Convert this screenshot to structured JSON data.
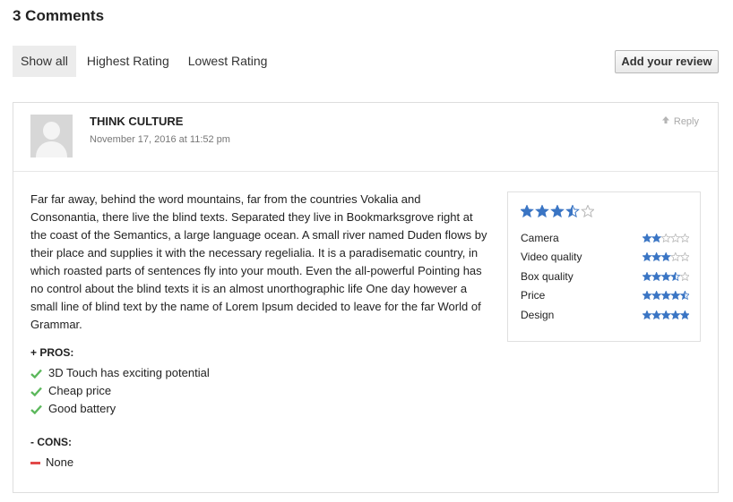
{
  "heading": "3 Comments",
  "filters": [
    "Show all",
    "Highest Rating",
    "Lowest Rating"
  ],
  "active_filter": "Show all",
  "add_review_label": "Add your review",
  "comment": {
    "author": "THINK CULTURE",
    "date": "November 17, 2016 at 11:52 pm",
    "reply_label": "Reply",
    "text": "Far far away, behind the word mountains, far from the countries Vokalia and Consonantia, there live the blind texts. Separated they live in Bookmarksgrove right at the coast of the Semantics, a large language ocean. A small river named Duden flows by their place and supplies it with the necessary regelialia. It is a paradisematic country, in which roasted parts of sentences fly into your mouth. Even the all-powerful Pointing has no control about the blind texts it is an almost unorthographic life One day however a small line of blind text by the name of Lorem Ipsum decided to leave for the far World of Grammar.",
    "pros_label": "+ PROS:",
    "pros": [
      "3D Touch has exciting potential",
      "Cheap price",
      "Good battery"
    ],
    "cons_label": "- CONS:",
    "cons": [
      "None"
    ],
    "overall_rating": 3.5,
    "ratings": [
      {
        "label": "Camera",
        "value": 2
      },
      {
        "label": "Video quality",
        "value": 3
      },
      {
        "label": "Box quality",
        "value": 3.5
      },
      {
        "label": "Price",
        "value": 4.5
      },
      {
        "label": "Design",
        "value": 5
      }
    ]
  },
  "colors": {
    "star": "#3a75c4",
    "check": "#5cb85c",
    "minus": "#e24a4a",
    "active_tab": "#ececec"
  },
  "icons": {
    "reply": "arrow-up-icon",
    "pro": "checkmark-icon",
    "con": "minus-icon",
    "avatar": "user-placeholder"
  }
}
